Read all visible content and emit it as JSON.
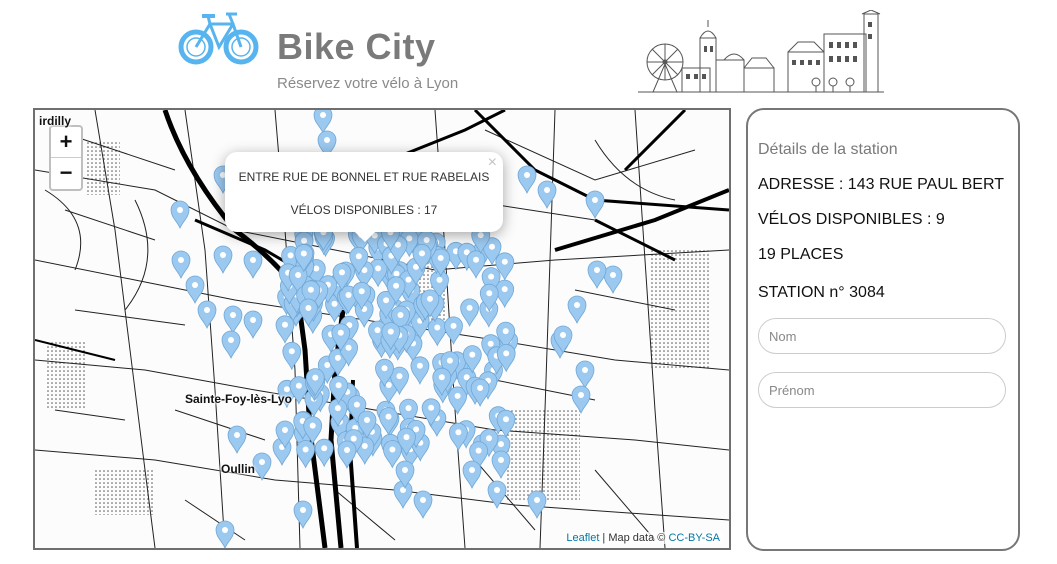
{
  "header": {
    "title": "Bike City",
    "subtitle": "Réservez votre vélo à Lyon"
  },
  "map": {
    "zoom_in_label": "+",
    "zoom_out_label": "−",
    "places": {
      "top": "irdilly",
      "west": "Sainte-Foy-lès-Lyo",
      "south": "Oullin"
    },
    "popup": {
      "close_label": "×",
      "station_name": "ENTRE RUE DE BONNEL ET RUE RABELAIS",
      "bikes_available": "VÉLOS DISPONIBLES : 17"
    },
    "attribution": {
      "leaflet": "Leaflet",
      "separator": " | Map data © ",
      "license": "CC-BY-SA"
    },
    "marker_color": "#9cc9f0"
  },
  "details": {
    "title": "Détails de la station",
    "address": "ADRESSE : 143 RUE PAUL BERT",
    "bikes": "VÉLOS DISPONIBLES : 9",
    "places": "19 PLACES",
    "station": "STATION n° 3084",
    "name_placeholder": "Nom",
    "firstname_placeholder": "Prénom"
  },
  "colors": {
    "brand_text": "#7a7a7a",
    "bike_blue": "#57b4ee",
    "marker": "#9cc9f0"
  }
}
